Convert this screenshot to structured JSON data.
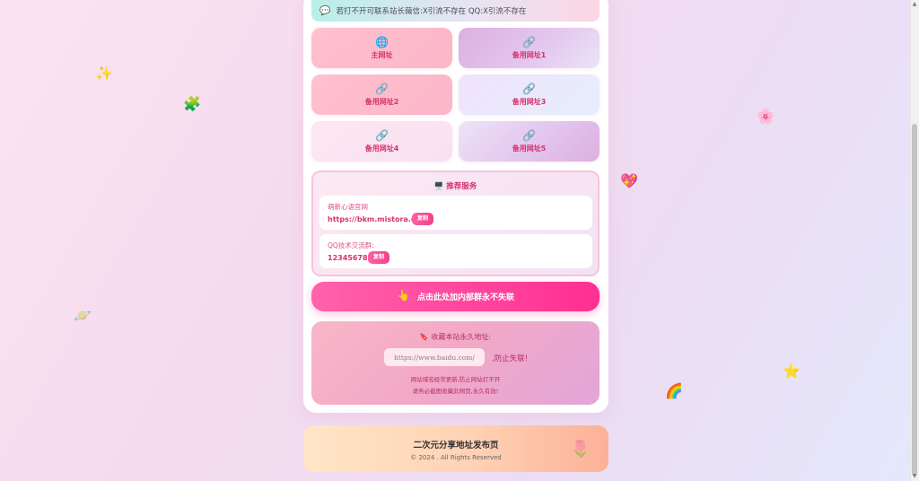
{
  "notice": {
    "icon": "speech-bubble-icon",
    "text": "若打不开可联系站长薇信:X引流不存在 QQ:X引流不存在"
  },
  "links": [
    {
      "label": "主网址",
      "icon": "globe-icon",
      "glyph": "🌐"
    },
    {
      "label": "备用网址1",
      "icon": "link-icon",
      "glyph": "🔗"
    },
    {
      "label": "备用网址2",
      "icon": "link-icon",
      "glyph": "🔗"
    },
    {
      "label": "备用网址3",
      "icon": "link-icon",
      "glyph": "🔗"
    },
    {
      "label": "备用网址4",
      "icon": "link-icon",
      "glyph": "🔗"
    },
    {
      "label": "备用网址5",
      "icon": "link-icon",
      "glyph": "🔗"
    }
  ],
  "services": {
    "title": "推荐服务",
    "title_icon": "🖥️",
    "items": [
      {
        "name": "萌新心语官网",
        "value": "https://bkm.mistora.cc/",
        "copy_label": "复制"
      },
      {
        "name": "QQ技术交流群:",
        "value": "123456789",
        "copy_label": "复制"
      }
    ]
  },
  "join": {
    "icon": "👆",
    "label": "点击此处加内部群永不失联"
  },
  "bookmark": {
    "icon": "🔖",
    "title": "收藏本站永久地址:",
    "url": "https://www.baidu.com/",
    "hint": ",防止失联!",
    "desc1": "网站域名经常更新,防止网站打不开",
    "desc2": "请务必截图收藏此网页,永久有效!"
  },
  "footer": {
    "title": "二次元分享地址发布页",
    "copyright": "© 2024 . All Rights Reserved"
  },
  "colors": {
    "accent": "#d6336c",
    "button": "#ff3f99"
  }
}
